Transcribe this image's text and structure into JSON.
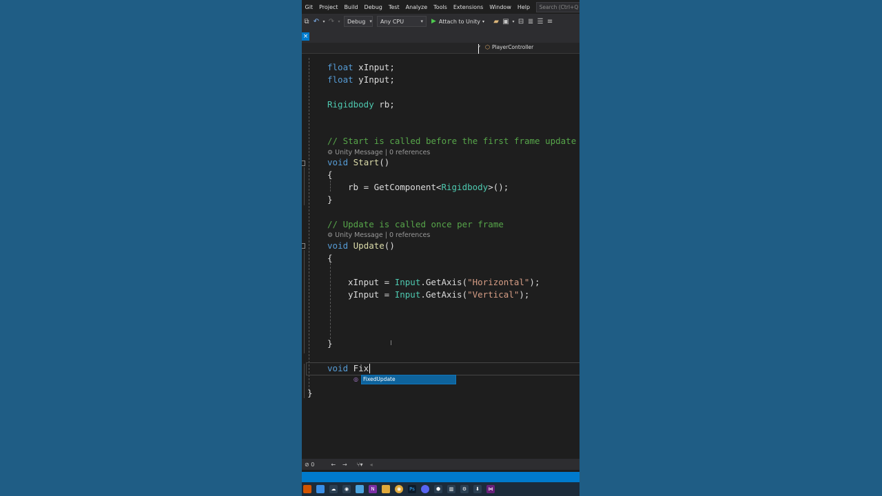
{
  "menu": {
    "items": [
      "Git",
      "Project",
      "Build",
      "Debug",
      "Test",
      "Analyze",
      "Tools",
      "Extensions",
      "Window",
      "Help"
    ],
    "search_placeholder": "Search (Ctrl+Q"
  },
  "toolbar": {
    "config": "Debug",
    "platform": "Any CPU",
    "attach_label": "Attach to Unity"
  },
  "navbar": {
    "class_name": "PlayerController"
  },
  "code": {
    "line1": "float xInput;",
    "line2": "float yInput;",
    "line3": "Rigidbody rb;",
    "comment_start": "// Start is called before the first frame update",
    "lens_start": "Unity Message | 0 references",
    "start_sig": "void Start()",
    "brace_open": "{",
    "start_body": "rb = GetComponent<Rigidbody>();",
    "brace_close": "}",
    "comment_update": "// Update is called once per frame",
    "lens_update": "Unity Message | 0 references",
    "update_sig": "void Update()",
    "update_body1": "xInput = Input.GetAxis(\"Horizontal\");",
    "update_body2": "yInput = Input.GetAxis(\"Vertical\");",
    "typing": "void Fix",
    "class_close": "}"
  },
  "autocomplete": {
    "suggestion": "FixedUpdate"
  },
  "bottom": {
    "errors": "0"
  },
  "colors": {
    "accent": "#007acc",
    "keyword": "#569cd6",
    "type": "#4ec9b0",
    "comment": "#57a64a",
    "string": "#d69d85"
  }
}
